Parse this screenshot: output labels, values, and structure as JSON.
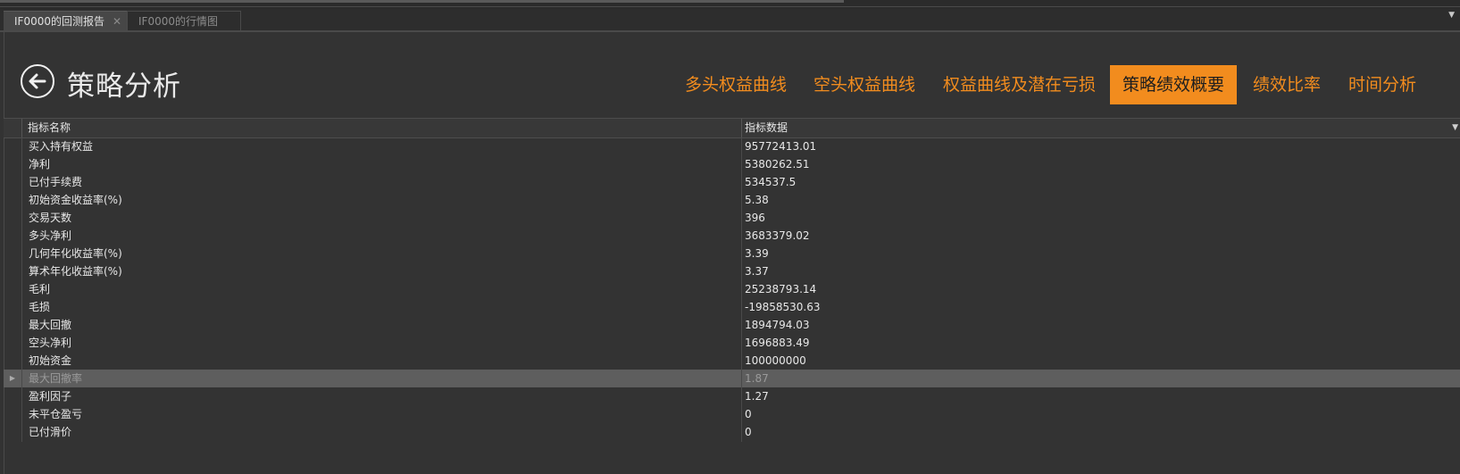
{
  "tabs": [
    {
      "label": "IF0000的回测报告",
      "active": true
    },
    {
      "label": "IF0000的行情图",
      "active": false
    }
  ],
  "header": {
    "title": "策略分析",
    "nav": [
      {
        "label": "多头权益曲线"
      },
      {
        "label": "空头权益曲线"
      },
      {
        "label": "权益曲线及潜在亏损"
      },
      {
        "label": "策略绩效概要",
        "active": true
      },
      {
        "label": "绩效比率"
      },
      {
        "label": "时间分析"
      }
    ]
  },
  "table": {
    "columns": [
      "指标名称",
      "指标数据"
    ],
    "rows": [
      {
        "name": "买入持有权益",
        "value": "95772413.01"
      },
      {
        "name": "净利",
        "value": "5380262.51"
      },
      {
        "name": "已付手续费",
        "value": "534537.5"
      },
      {
        "name": "初始资金收益率(%)",
        "value": "5.38"
      },
      {
        "name": "交易天数",
        "value": "396"
      },
      {
        "name": "多头净利",
        "value": "3683379.02"
      },
      {
        "name": "几何年化收益率(%)",
        "value": "3.39"
      },
      {
        "name": "算术年化收益率(%)",
        "value": "3.37"
      },
      {
        "name": "毛利",
        "value": "25238793.14"
      },
      {
        "name": "毛损",
        "value": "-19858530.63"
      },
      {
        "name": "最大回撤",
        "value": "1894794.03"
      },
      {
        "name": "空头净利",
        "value": "1696883.49"
      },
      {
        "name": "初始资金",
        "value": "100000000"
      },
      {
        "name": "最大回撤率",
        "value": "1.87",
        "selected": true
      },
      {
        "name": "盈利因子",
        "value": "1.27"
      },
      {
        "name": "未平仓盈亏",
        "value": "0"
      },
      {
        "name": "已付滑价",
        "value": "0"
      }
    ]
  },
  "colors": {
    "accent": "#f28c1e",
    "background": "#333333",
    "selected_row": "#5e5e5e"
  },
  "icons": {
    "back": "back-arrow-icon",
    "close": "close-icon",
    "dropdown": "caret-down-icon"
  }
}
